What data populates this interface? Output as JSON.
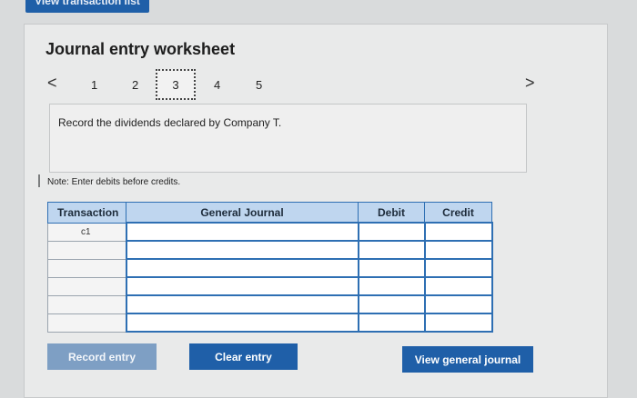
{
  "top_tab": {
    "label": "View transaction list"
  },
  "worksheet": {
    "title": "Journal entry worksheet",
    "steps": [
      "1",
      "2",
      "3",
      "4",
      "5"
    ],
    "active_step": "3",
    "prev_icon": "<",
    "next_icon": ">",
    "prompt": "Record the dividends declared by Company T.",
    "note": "Note: Enter debits before credits."
  },
  "table": {
    "headers": {
      "transaction": "Transaction",
      "general_journal": "General Journal",
      "debit": "Debit",
      "credit": "Credit"
    },
    "rows": [
      {
        "transaction": "c1"
      },
      {
        "transaction": ""
      },
      {
        "transaction": ""
      },
      {
        "transaction": ""
      },
      {
        "transaction": ""
      },
      {
        "transaction": ""
      }
    ]
  },
  "buttons": {
    "record": "Record entry",
    "clear": "Clear entry",
    "view": "View general journal"
  },
  "colors": {
    "accent": "#1f5fa8",
    "header_bg": "#bfd6ef",
    "disabled_button": "#7e9fc4"
  }
}
